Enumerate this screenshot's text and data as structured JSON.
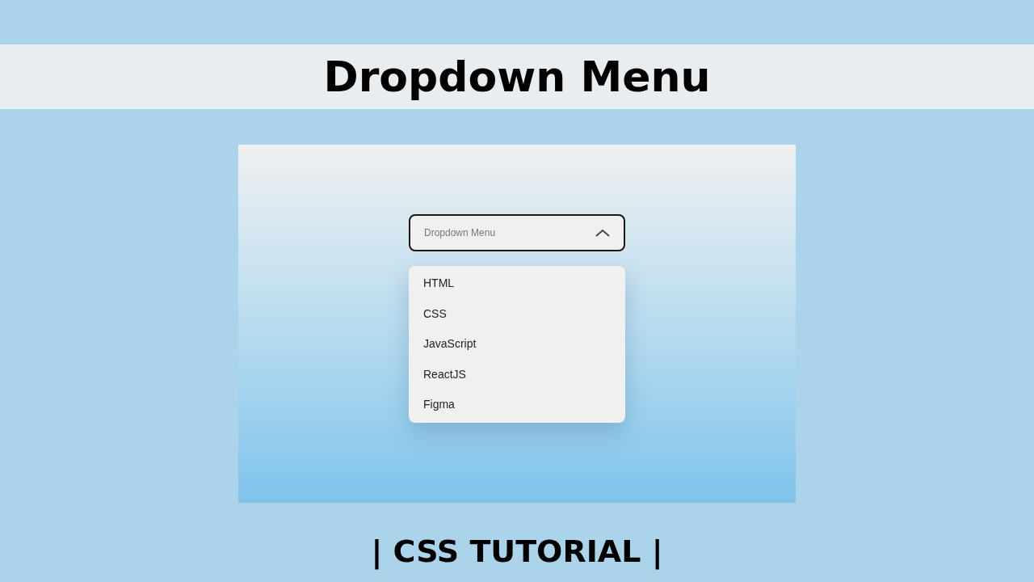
{
  "banner": {
    "title": "Dropdown Menu"
  },
  "dropdown": {
    "placeholder": "Dropdown Menu",
    "expanded": true,
    "items": [
      {
        "label": "HTML"
      },
      {
        "label": "CSS"
      },
      {
        "label": "JavaScript"
      },
      {
        "label": "ReactJS"
      },
      {
        "label": "Figma"
      }
    ]
  },
  "caption": "| CSS TUTORIAL |"
}
